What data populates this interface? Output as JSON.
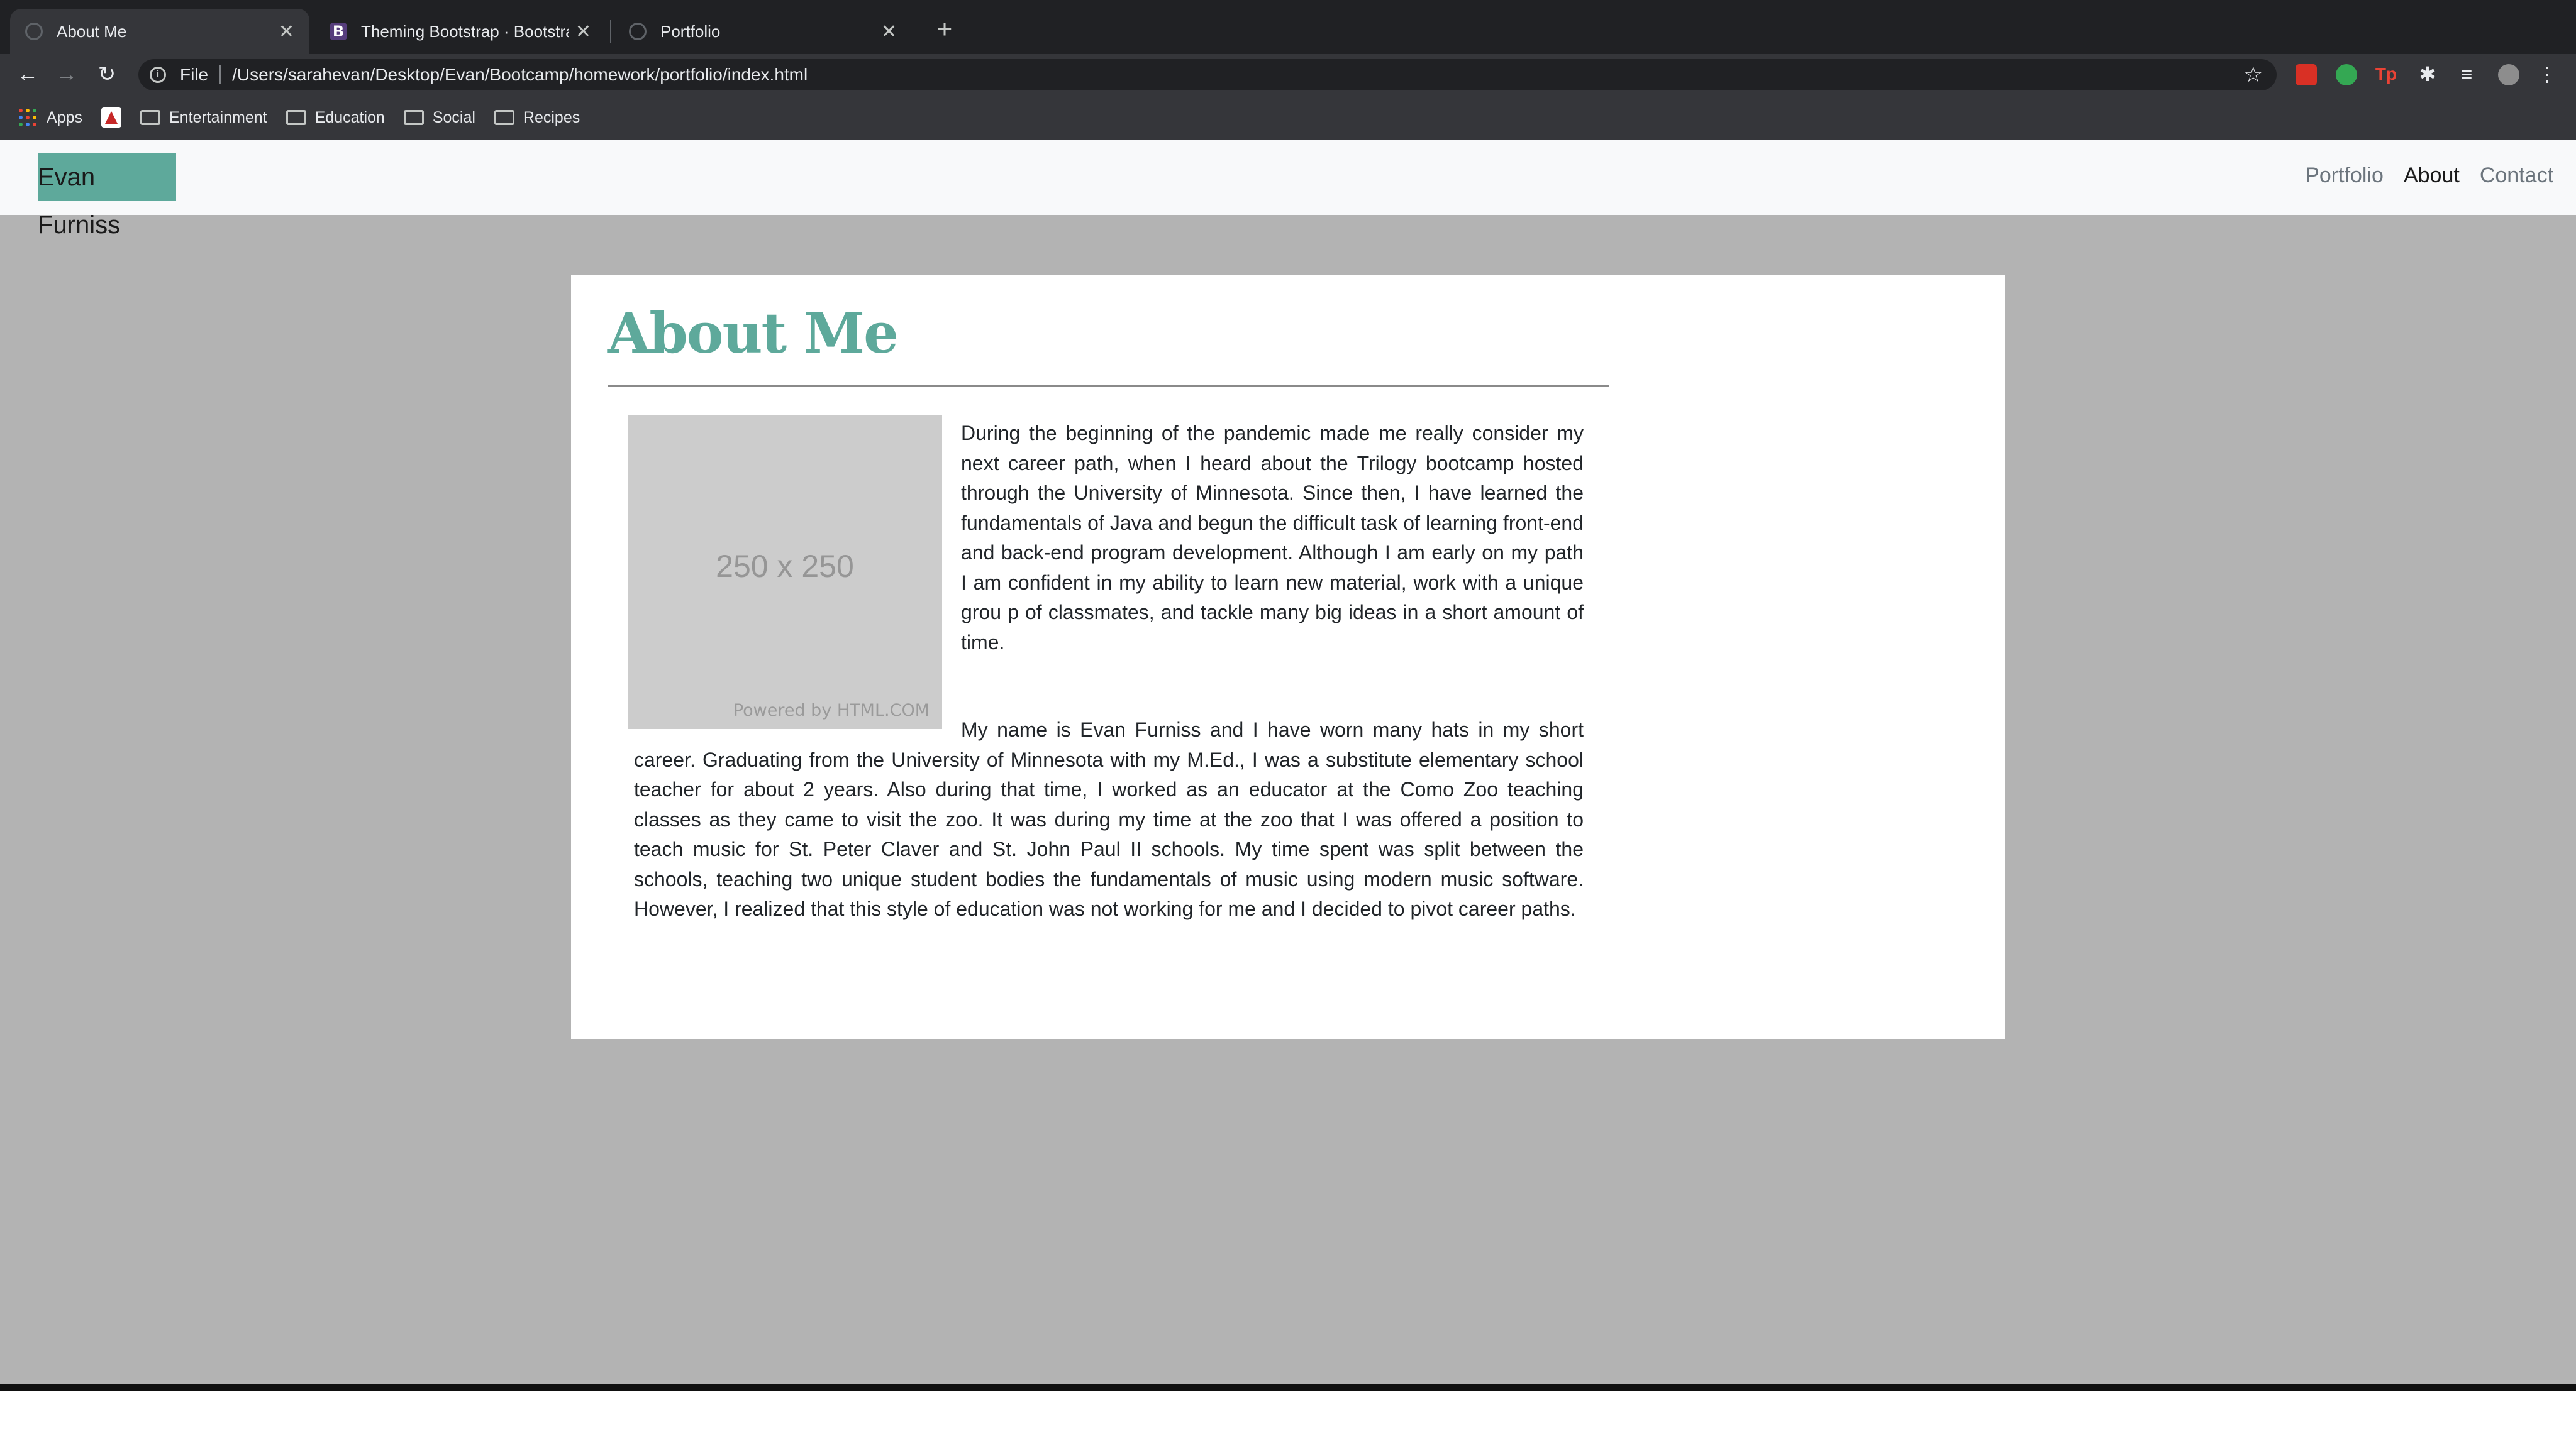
{
  "browser": {
    "tabs": [
      {
        "title": "About Me",
        "icon": "globe-icon",
        "active": true
      },
      {
        "title": "Theming Bootstrap · Bootstrap",
        "icon": "bootstrap-icon",
        "active": false
      },
      {
        "title": "Portfolio",
        "icon": "globe-icon",
        "active": false
      }
    ],
    "bootstrap_icon_letter": "B",
    "address": {
      "scheme": "File",
      "url": "/Users/sarahevan/Desktop/Evan/Bootcamp/homework/portfolio/index.html"
    },
    "bookmarks": [
      {
        "label": "Apps",
        "icon": "apps-grid-icon"
      },
      {
        "label": "",
        "icon": "bookmark-logo-icon"
      },
      {
        "label": "Entertainment",
        "icon": "folder-icon"
      },
      {
        "label": "Education",
        "icon": "folder-icon"
      },
      {
        "label": "Social",
        "icon": "folder-icon"
      },
      {
        "label": "Recipes",
        "icon": "folder-icon"
      }
    ],
    "extensions": [
      "red-extension-icon",
      "green-extension-icon",
      "tp-extension-icon",
      "puzzle-icon",
      "media-queue-icon",
      "profile-avatar",
      "kebab-menu-icon"
    ],
    "ext_tp_text": "Tp"
  },
  "site": {
    "brand": "Evan Furniss",
    "nav": [
      {
        "label": "Portfolio",
        "active": false
      },
      {
        "label": "About",
        "active": true
      },
      {
        "label": "Contact",
        "active": false
      }
    ]
  },
  "about": {
    "heading": "About Me",
    "image": {
      "dimensions": "250 x 250",
      "credit": "Powered by HTML.COM"
    },
    "paragraph1": "During the beginning of the pandemic made me really consider my next career path, when I heard about the Trilogy bootcamp hosted through the University of Minnesota. Since then, I have learned the fundamentals of Java and begun the difficult task of learning front-end and back-end program development. Although I am early on my path I am confident in my ability to learn new material, work with a unique grou p of classmates, and tackle many big ideas in a short amount of time.",
    "paragraph2": "My name is Evan Furniss and I have worn many hats in my short career. Graduating from the University of Minnesota with my M.Ed., I was a substitute elementary school teacher for about 2 years. Also during that time, I worked as an educator at the Como Zoo teaching classes as they came to visit the zoo. It was during my time at the zoo that I was offered a position to teach music for St. Peter Claver and St. John Paul II schools. My time spent was split between the schools, teaching two unique student bodies the fundamentals of music using modern music software. However, I realized that this style of education was not working for me and I decided to pivot career paths."
  },
  "colors": {
    "accent": "#5ea99b",
    "page_background": "#b3b3b3",
    "chrome_dark": "#202124",
    "chrome": "#35363a"
  }
}
